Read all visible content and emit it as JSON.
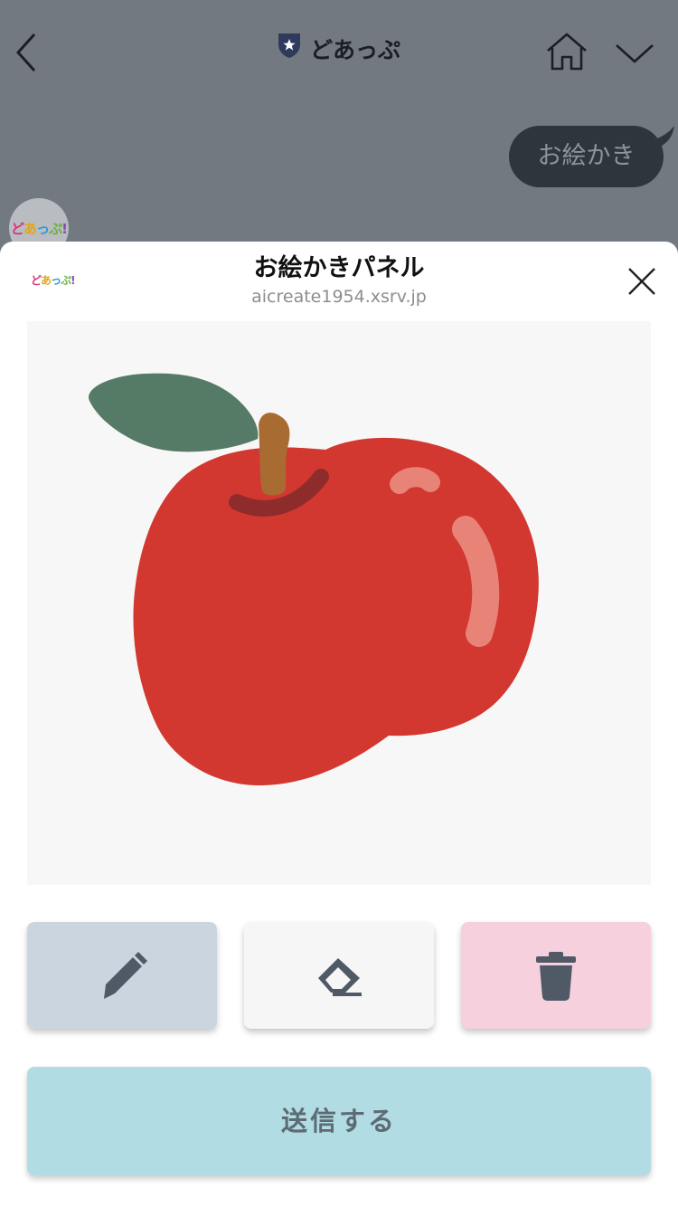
{
  "header": {
    "back_icon": "chevron-left-icon",
    "title": "どあっぷ",
    "shield_icon": "shield-star-icon",
    "home_icon": "home-icon",
    "menu_icon": "chevron-down-icon"
  },
  "chat": {
    "message": "お絵かき",
    "bot_logo": [
      "ど",
      "あ",
      "っ",
      "ぷ",
      "!"
    ]
  },
  "panel": {
    "logo": [
      "ど",
      "あ",
      "っ",
      "ぷ",
      "!"
    ],
    "title": "お絵かきパネル",
    "domain": "aicreate1954.xsrv.jp",
    "close_icon": "close-icon",
    "tools": [
      {
        "name": "pen",
        "icon": "pencil-icon",
        "active": true
      },
      {
        "name": "eraser",
        "icon": "eraser-icon",
        "active": false
      },
      {
        "name": "clear",
        "icon": "trash-icon",
        "active": false
      }
    ],
    "send_label": "送信する"
  },
  "colors": {
    "overlay": "#727980",
    "bubble": "#2e353d",
    "pen_button": "#cbd5df",
    "eraser_button": "#f6f6f6",
    "trash_button": "#f6d0dd",
    "send_button": "#b2dce3",
    "apple_red": "#d2382f",
    "leaf_green": "#557a66",
    "stem_brown": "#a86b32"
  }
}
